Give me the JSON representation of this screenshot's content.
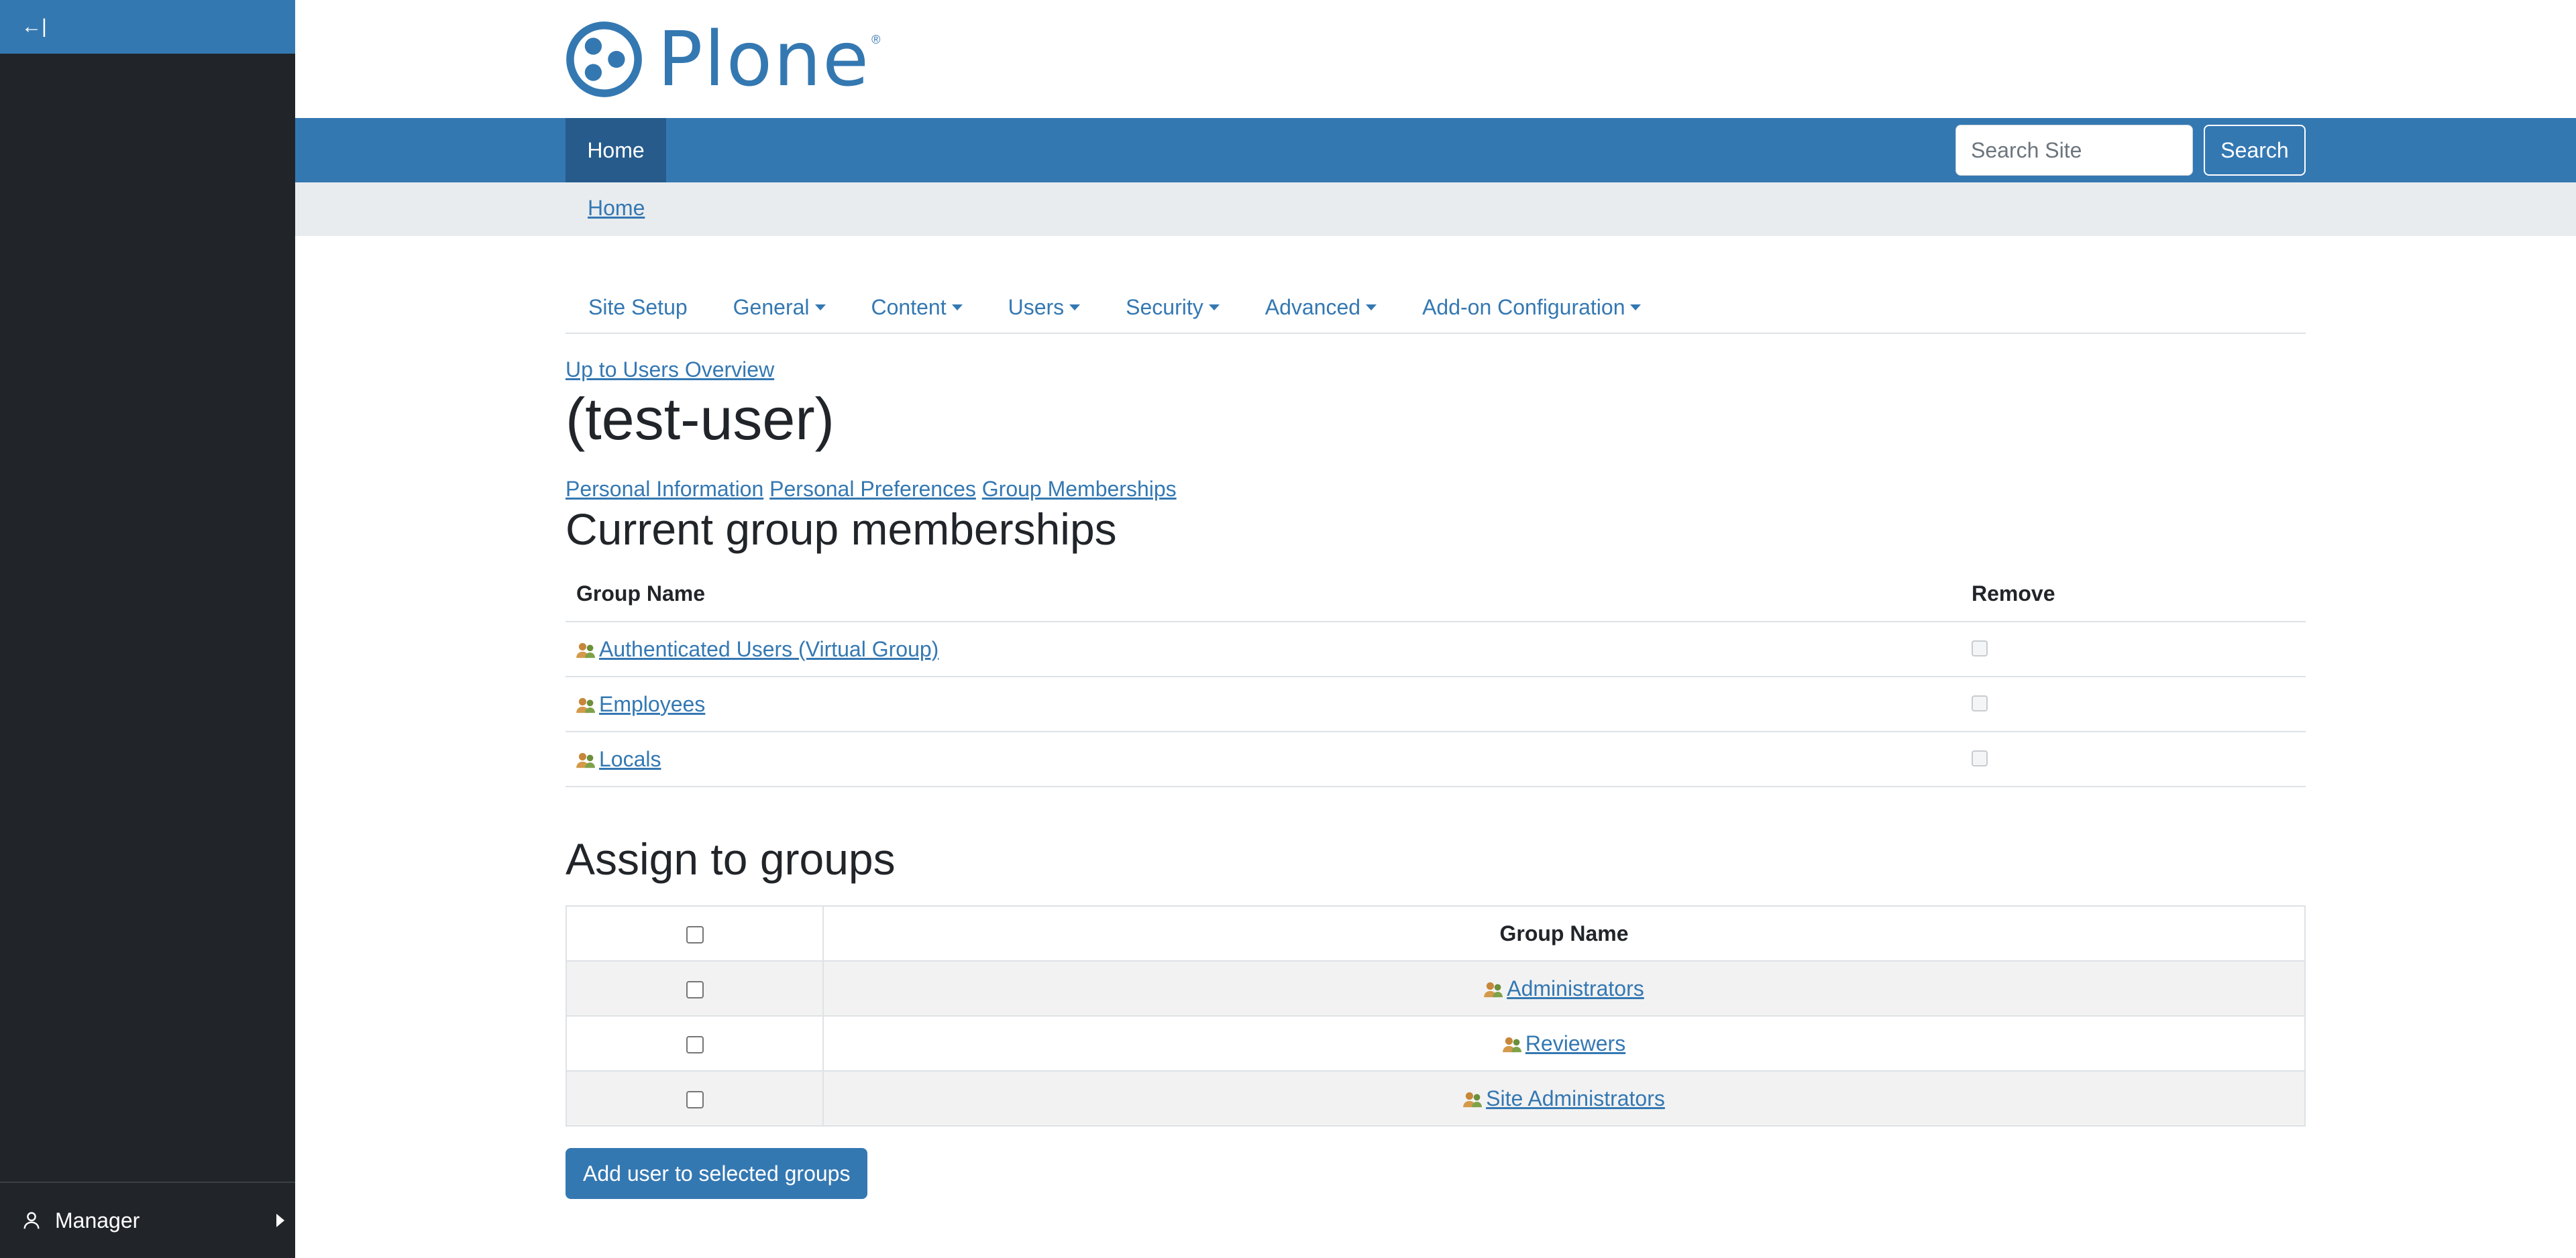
{
  "toolbar": {
    "collapse_icon_name": "collapse-arrow-icon",
    "collapse_glyph": "←|",
    "user_label": "Manager",
    "user_icon_name": "user-icon"
  },
  "header": {
    "logo_text": "Plone",
    "logo_mark": "®",
    "brand_color": "#3478b2"
  },
  "navbar": {
    "home_label": "Home",
    "search_placeholder": "Search Site",
    "search_button": "Search"
  },
  "breadcrumb": {
    "home": "Home"
  },
  "setup_menu": {
    "items": [
      {
        "label": "Site Setup",
        "dropdown": false
      },
      {
        "label": "General",
        "dropdown": true
      },
      {
        "label": "Content",
        "dropdown": true
      },
      {
        "label": "Users",
        "dropdown": true
      },
      {
        "label": "Security",
        "dropdown": true
      },
      {
        "label": "Advanced",
        "dropdown": true
      },
      {
        "label": "Add-on Configuration",
        "dropdown": true
      }
    ]
  },
  "page": {
    "up_link": "Up to Users Overview",
    "title": "(test-user)",
    "subnav": [
      "Personal Information",
      "Personal Preferences",
      "Group Memberships"
    ]
  },
  "current": {
    "heading": "Current group memberships",
    "col_group": "Group Name",
    "col_remove": "Remove",
    "rows": [
      {
        "name": "Authenticated Users (Virtual Group)"
      },
      {
        "name": "Employees"
      },
      {
        "name": "Locals"
      }
    ]
  },
  "assign": {
    "heading": "Assign to groups",
    "col_group": "Group Name",
    "rows": [
      {
        "name": "Administrators"
      },
      {
        "name": "Reviewers"
      },
      {
        "name": "Site Administrators"
      }
    ],
    "button": "Add user to selected groups"
  }
}
